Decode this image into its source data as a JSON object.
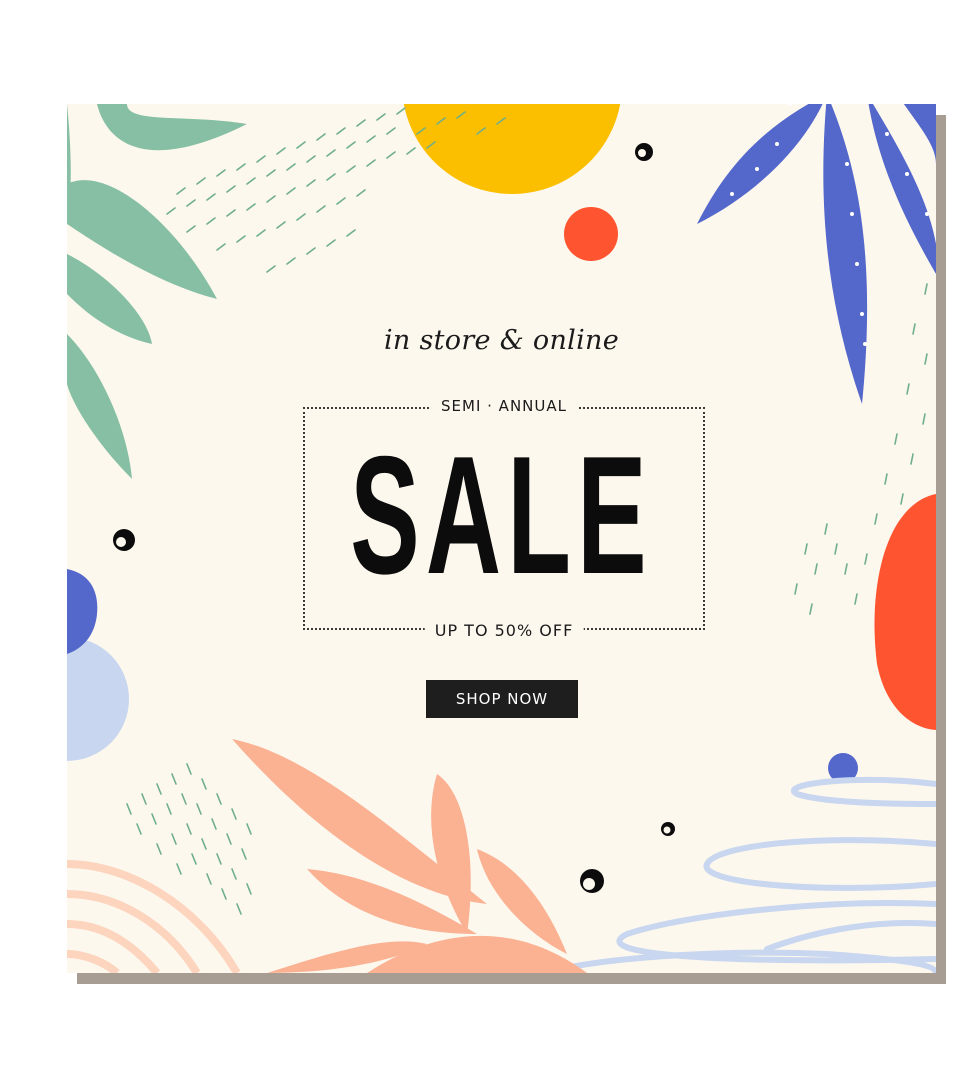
{
  "banner": {
    "tagline": "in store & online",
    "eyebrow": "SEMI · ANNUAL",
    "headline": "SALE",
    "offer": "UP TO 50% OFF",
    "cta_label": "SHOP NOW"
  },
  "colors": {
    "background": "#fdf8ee",
    "shadow": "#a79d93",
    "green_leaf": "#86bfa4",
    "blue_leaf": "#5467cb",
    "yellow_circle": "#fbbf00",
    "orange_dot": "#ff5430",
    "peach_leaf": "#fbb293",
    "light_blue": "#c8d6ef",
    "button": "#1e1e1e"
  },
  "icons": [
    "green-leaf-icon",
    "blue-leaf-icon",
    "peach-leaf-icon",
    "yellow-circle-icon",
    "orange-dot-icon",
    "scribble-icon",
    "bubble-icon"
  ]
}
